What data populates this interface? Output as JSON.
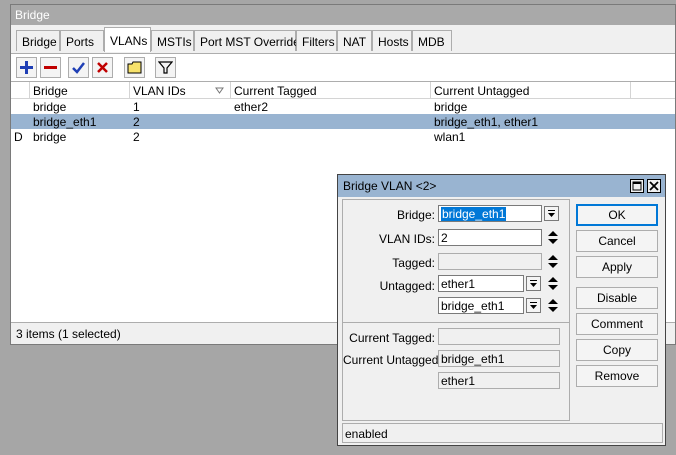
{
  "main_window": {
    "title": "Bridge",
    "tabs": [
      "Bridge",
      "Ports",
      "VLANs",
      "MSTIs",
      "Port MST Overrides",
      "Filters",
      "NAT",
      "Hosts",
      "MDB"
    ],
    "active_tab": "VLANs",
    "toolbar": [
      "add-icon",
      "remove-icon",
      "enable-icon",
      "disable-icon",
      "comment-icon",
      "filter-icon"
    ],
    "table": {
      "columns": [
        "",
        "Bridge",
        "VLAN IDs",
        "Current Tagged",
        "Current Untagged"
      ],
      "rows": [
        {
          "flag": "",
          "bridge": "bridge",
          "vlan_ids": "1",
          "current_tagged": "ether2",
          "current_untagged": "bridge",
          "selected": false
        },
        {
          "flag": "",
          "bridge": "bridge_eth1",
          "vlan_ids": "2",
          "current_tagged": "",
          "current_untagged": "bridge_eth1, ether1",
          "selected": true
        },
        {
          "flag": "D",
          "bridge": "bridge",
          "vlan_ids": "2",
          "current_tagged": "",
          "current_untagged": "wlan1",
          "selected": false
        }
      ]
    },
    "status": "3 items (1 selected)"
  },
  "dialog": {
    "title": "Bridge VLAN <2>",
    "labels": {
      "bridge": "Bridge:",
      "vlan_ids": "VLAN IDs:",
      "tagged": "Tagged:",
      "untagged": "Untagged:",
      "current_tagged": "Current Tagged:",
      "current_untagged": "Current Untagged:"
    },
    "values": {
      "bridge": "bridge_eth1",
      "vlan_ids": "2",
      "tagged": "",
      "untagged": [
        "ether1",
        "bridge_eth1"
      ],
      "current_tagged": "",
      "current_untagged": [
        "bridge_eth1",
        "ether1"
      ]
    },
    "buttons": {
      "ok": "OK",
      "cancel": "Cancel",
      "apply": "Apply",
      "disable": "Disable",
      "comment": "Comment",
      "copy": "Copy",
      "remove": "Remove"
    },
    "status": "enabled"
  }
}
